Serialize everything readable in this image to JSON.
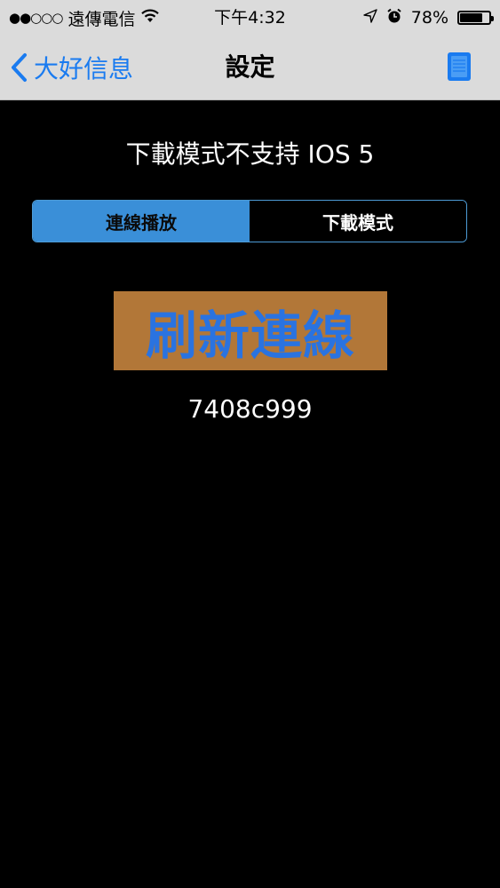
{
  "status_bar": {
    "signal": "●●○○○",
    "carrier": "遠傳電信",
    "time": "下午4:32",
    "battery": "78%",
    "battery_level": 0.78
  },
  "nav": {
    "back_label": "大好信息",
    "title": "設定"
  },
  "notice": "下載模式不支持 IOS 5",
  "segment": {
    "options": [
      "連線播放",
      "下載模式"
    ],
    "selected": "連線播放"
  },
  "refresh_button": "刷新連線",
  "code": "7408c999",
  "colors": {
    "accent": "#1a7bf0",
    "segment_active": "#3a8fd8",
    "refresh_bg": "#b27738",
    "refresh_text": "#2a73e0"
  }
}
